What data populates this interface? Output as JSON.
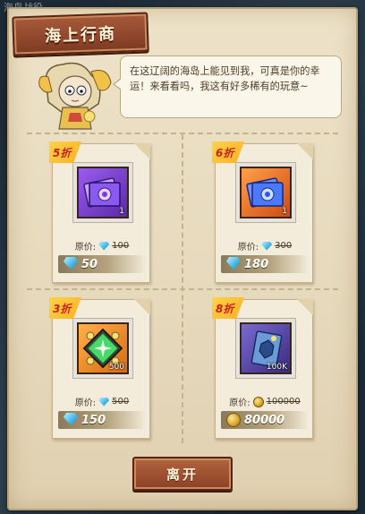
{
  "header": {
    "title": "海上行商",
    "background_label": "海岛战役"
  },
  "npc": {
    "dialogue": "在这辽阔的海岛上能见到我，可真是你的幸运！来看看吗，我这有好多稀有的玩意~"
  },
  "shop": {
    "original_price_label": "原价:",
    "items": [
      {
        "discount": "5折",
        "icon": "purple-ticket-icon",
        "quantity": "1",
        "currency": "diamond",
        "original_price": "100",
        "price": "50",
        "icon_color": "#7d44d8"
      },
      {
        "discount": "6折",
        "icon": "orange-ticket-icon",
        "quantity": "1",
        "currency": "diamond",
        "original_price": "300",
        "price": "180",
        "icon_color": "#e86a22"
      },
      {
        "discount": "3折",
        "icon": "green-scroll-icon",
        "quantity": "500",
        "currency": "diamond",
        "original_price": "500",
        "price": "150",
        "icon_color": "#e8871f"
      },
      {
        "discount": "8折",
        "icon": "blue-card-icon",
        "quantity": "100K",
        "currency": "gold-coin",
        "original_price": "100000",
        "price": "80000",
        "icon_color": "#5a4aa8"
      }
    ]
  },
  "footer": {
    "leave_label": "离开"
  },
  "colors": {
    "accent": "#8d4126",
    "parchment": "#ede2c8",
    "discount_tag": "#ffc02a"
  }
}
